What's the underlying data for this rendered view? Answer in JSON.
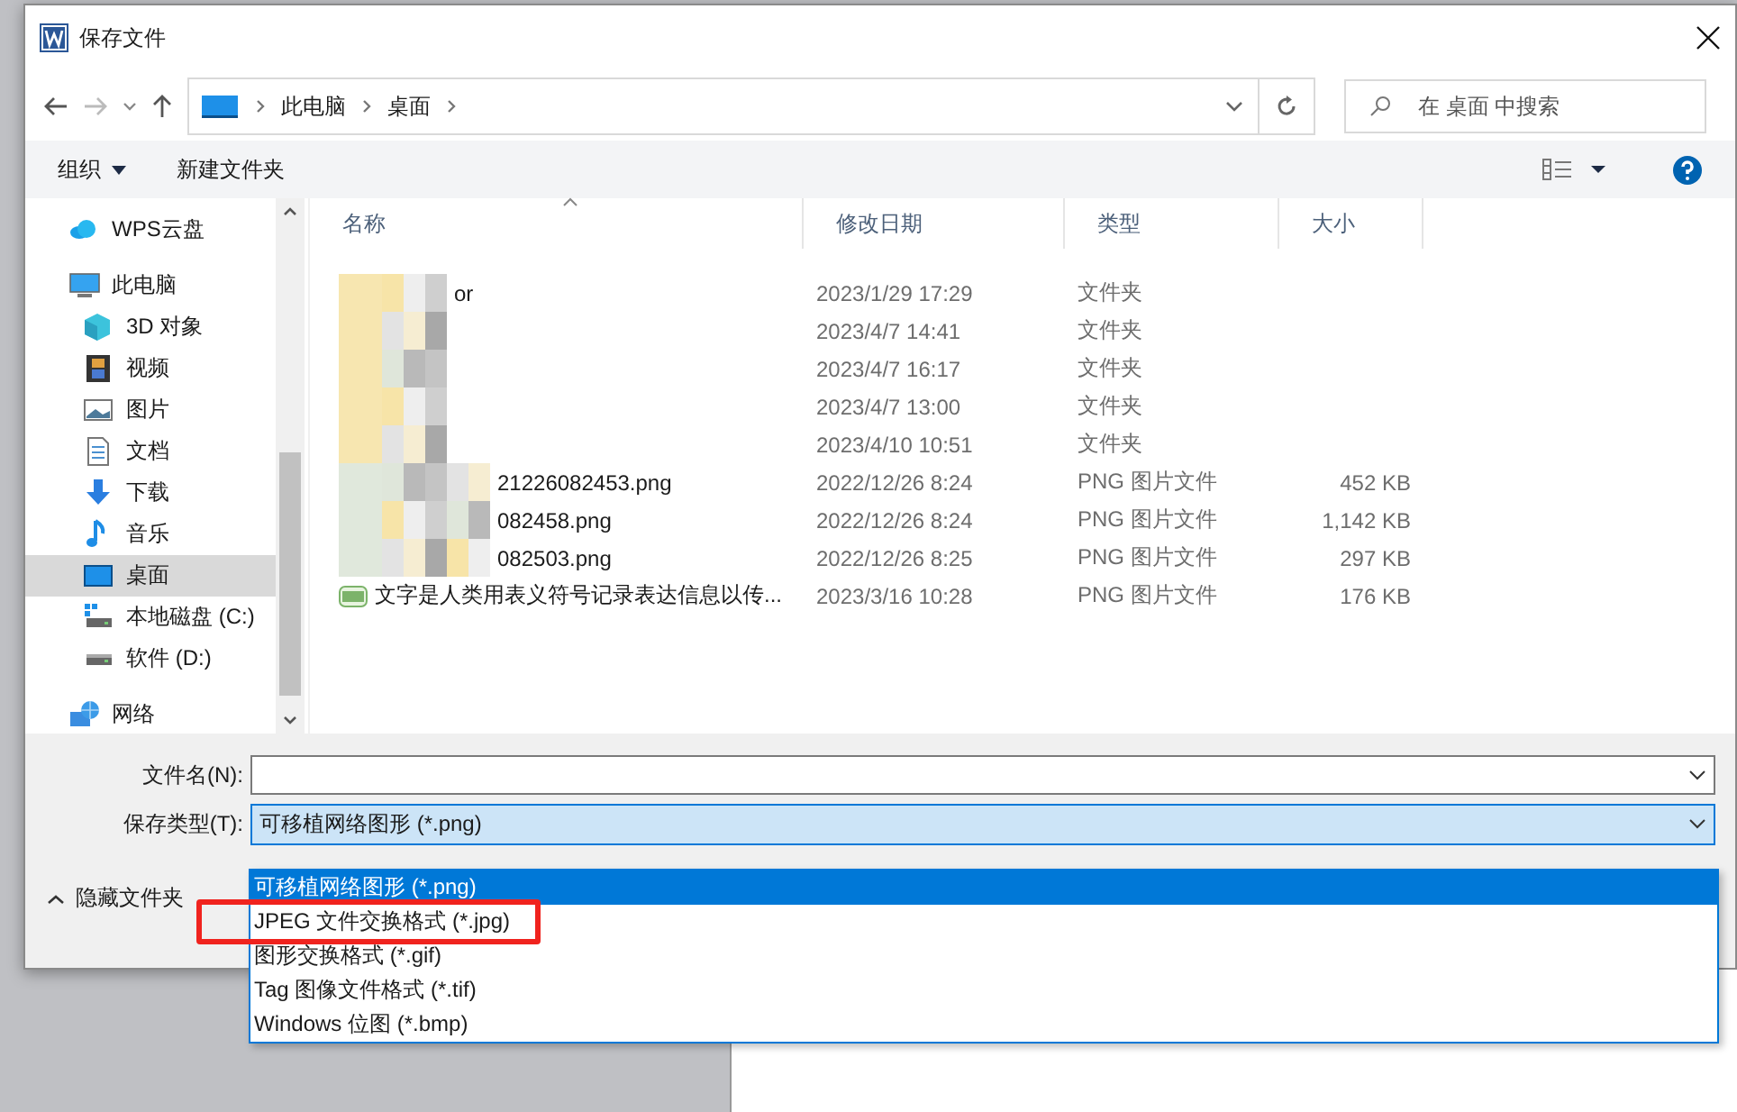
{
  "window": {
    "title": "保存文件"
  },
  "address": {
    "segments": [
      "此电脑",
      "桌面"
    ]
  },
  "search": {
    "placeholder": "在 桌面 中搜索"
  },
  "toolbar": {
    "organize": "组织",
    "new_folder": "新建文件夹"
  },
  "sidebar": {
    "items": [
      {
        "label": "WPS云盘",
        "kind": "cloud",
        "selected": false
      },
      {
        "label": "此电脑",
        "kind": "pc",
        "selected": false,
        "children": [
          {
            "label": "3D 对象",
            "kind": "cube",
            "selected": false
          },
          {
            "label": "视频",
            "kind": "video",
            "selected": false
          },
          {
            "label": "图片",
            "kind": "pictures",
            "selected": false
          },
          {
            "label": "文档",
            "kind": "docs",
            "selected": false
          },
          {
            "label": "下载",
            "kind": "download",
            "selected": false
          },
          {
            "label": "音乐",
            "kind": "music",
            "selected": false
          },
          {
            "label": "桌面",
            "kind": "desktop",
            "selected": true
          },
          {
            "label": "本地磁盘 (C:)",
            "kind": "sysdrive",
            "selected": false
          },
          {
            "label": "软件 (D:)",
            "kind": "drive",
            "selected": false
          }
        ]
      },
      {
        "label": "网络",
        "kind": "network",
        "selected": false
      }
    ]
  },
  "file_list": {
    "columns": [
      "名称",
      "修改日期",
      "类型",
      "大小"
    ],
    "rows": [
      {
        "kind": "folder",
        "blurred": true,
        "name": "or",
        "date": "2023/1/29 17:29",
        "type": "文件夹"
      },
      {
        "kind": "folder",
        "blurred": true,
        "date": "2023/4/7 14:41",
        "type": "文件夹"
      },
      {
        "kind": "folder",
        "blurred": true,
        "date": "2023/4/7 16:17",
        "type": "文件夹"
      },
      {
        "kind": "folder",
        "blurred": true,
        "date": "2023/4/7 13:00",
        "type": "文件夹"
      },
      {
        "kind": "folder",
        "blurred": true,
        "date": "2023/4/10 10:51",
        "type": "文件夹"
      },
      {
        "kind": "png",
        "blurred": true,
        "name": "21226082453.png",
        "date": "2022/12/26 8:24",
        "type": "PNG 图片文件",
        "size": "452 KB"
      },
      {
        "kind": "png",
        "blurred": true,
        "name": "082458.png",
        "date": "2022/12/26 8:24",
        "type": "PNG 图片文件",
        "size": "1,142 KB"
      },
      {
        "kind": "png",
        "blurred": true,
        "name": "082503.png",
        "date": "2022/12/26 8:25",
        "type": "PNG 图片文件",
        "size": "297 KB"
      },
      {
        "kind": "png",
        "blurred": false,
        "name": "文字是人类用表义符号记录表达信息以传...",
        "date": "2023/3/16 10:28",
        "type": "PNG 图片文件",
        "size": "176 KB"
      }
    ]
  },
  "file_name": {
    "label": "文件名(N):"
  },
  "save_type": {
    "label": "保存类型(T):",
    "value": "可移植网络图形 (*.png)",
    "options": [
      {
        "label": "可移植网络图形 (*.png)",
        "selected": true
      },
      {
        "label": "JPEG 文件交换格式 (*.jpg)",
        "selected": false
      },
      {
        "label": "图形交换格式 (*.gif)",
        "selected": false
      },
      {
        "label": "Tag 图像文件格式 (*.tif)",
        "selected": false
      },
      {
        "label": "Windows 位图 (*.bmp)",
        "selected": false
      }
    ]
  },
  "hide_folders": {
    "label": "隐藏文件夹"
  }
}
